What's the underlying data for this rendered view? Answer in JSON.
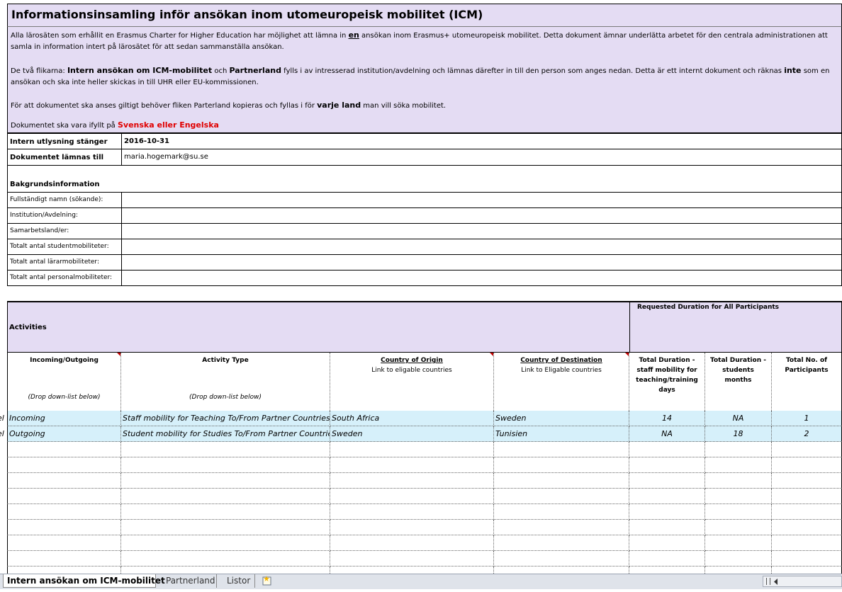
{
  "header": {
    "title": "Informationsinsamling inför ansökan inom utomeuropeisk mobilitet (ICM)",
    "intro1_a": "Alla  lärosäten som erhållit en Erasmus Charter for Higher Education har möjlighet att lämna in ",
    "intro1_b": "en",
    "intro1_c": " ansökan inom Erasmus+ utomeuropeisk mobilitet. Detta dokument ämnar underlätta arbetet för den centrala administrationen att samla in information intert på lärosätet för att sedan sammanställa ansökan.",
    "intro2_a": "De två flikarna: ",
    "intro2_b": "Intern ansökan om ICM-mobilitet",
    "intro2_c": " och ",
    "intro2_d": "Partnerland",
    "intro2_e": " fylls i av intresserad institution/avdelning och lämnas därefter in till den person som anges nedan. Detta är ett internt dokument och räknas ",
    "intro2_f": "inte",
    "intro2_g": " som en ansökan och ska inte heller skickas in till UHR eller EU-kommissionen.",
    "intro3_a": "För att dokumentet ska anses giltigt behöver fliken Parterland kopieras och fyllas i för ",
    "intro3_b": "varje land",
    "intro3_c": " man vill söka mobilitet.",
    "intro4_a": "Dokumentet ska vara ifyllt på ",
    "intro4_b": "Svenska eller Engelska"
  },
  "info": {
    "closing_label": "Intern utlysning stänger",
    "closing_value": "2016-10-31",
    "submit_label": "Dokumentet lämnas till",
    "submit_value": "maria.hogemark@su.se",
    "background_heading": "Bakgrundsinformation",
    "fields": [
      "Fullständigt namn (sökande):",
      "Institution/Avdelning:",
      "Samarbetsland/er:",
      "Totalt antal studentmobiliteter:",
      "Totalt antal lärarmobiliteter:",
      "Totalt antal personalmobiliteter:"
    ]
  },
  "activities": {
    "heading": "Activities",
    "duration_heading": "Requested Duration for All Participants",
    "columns": {
      "inout": "Incoming/Outgoing",
      "inout_note": "(Drop down-list below)",
      "type": "Activity Type",
      "type_note": "(Drop down-list below)",
      "origin": "Country of Origin",
      "origin_sub": "Link to eligable countries",
      "dest": "Country of Destination",
      "dest_sub": "Link to Eligable countries",
      "staff_days": "Total Duration - staff mobility for teaching/training days",
      "student_months": "Total Duration - students months",
      "participants": "Total No. of Participants"
    },
    "left_marker": "el",
    "rows": [
      {
        "inout": "Incoming",
        "type": "Staff mobility for Teaching To/From Partner Countries",
        "origin": "South Africa",
        "dest": "Sweden",
        "staff": "14",
        "students": "NA",
        "participants": "1"
      },
      {
        "inout": "Outgoing",
        "type": "Student mobility for Studies To/From Partner Countries",
        "origin": "Sweden",
        "dest": "Tunisien",
        "staff": "NA",
        "students": "18",
        "participants": "2"
      }
    ]
  },
  "tabs": [
    "Intern ansökan om ICM-mobilitet",
    "Partnerland",
    "Listor"
  ],
  "colors": {
    "header_bg": "#e4dcf3",
    "row_highlight": "#d6f0fa",
    "emphasis_red": "#e00000"
  }
}
